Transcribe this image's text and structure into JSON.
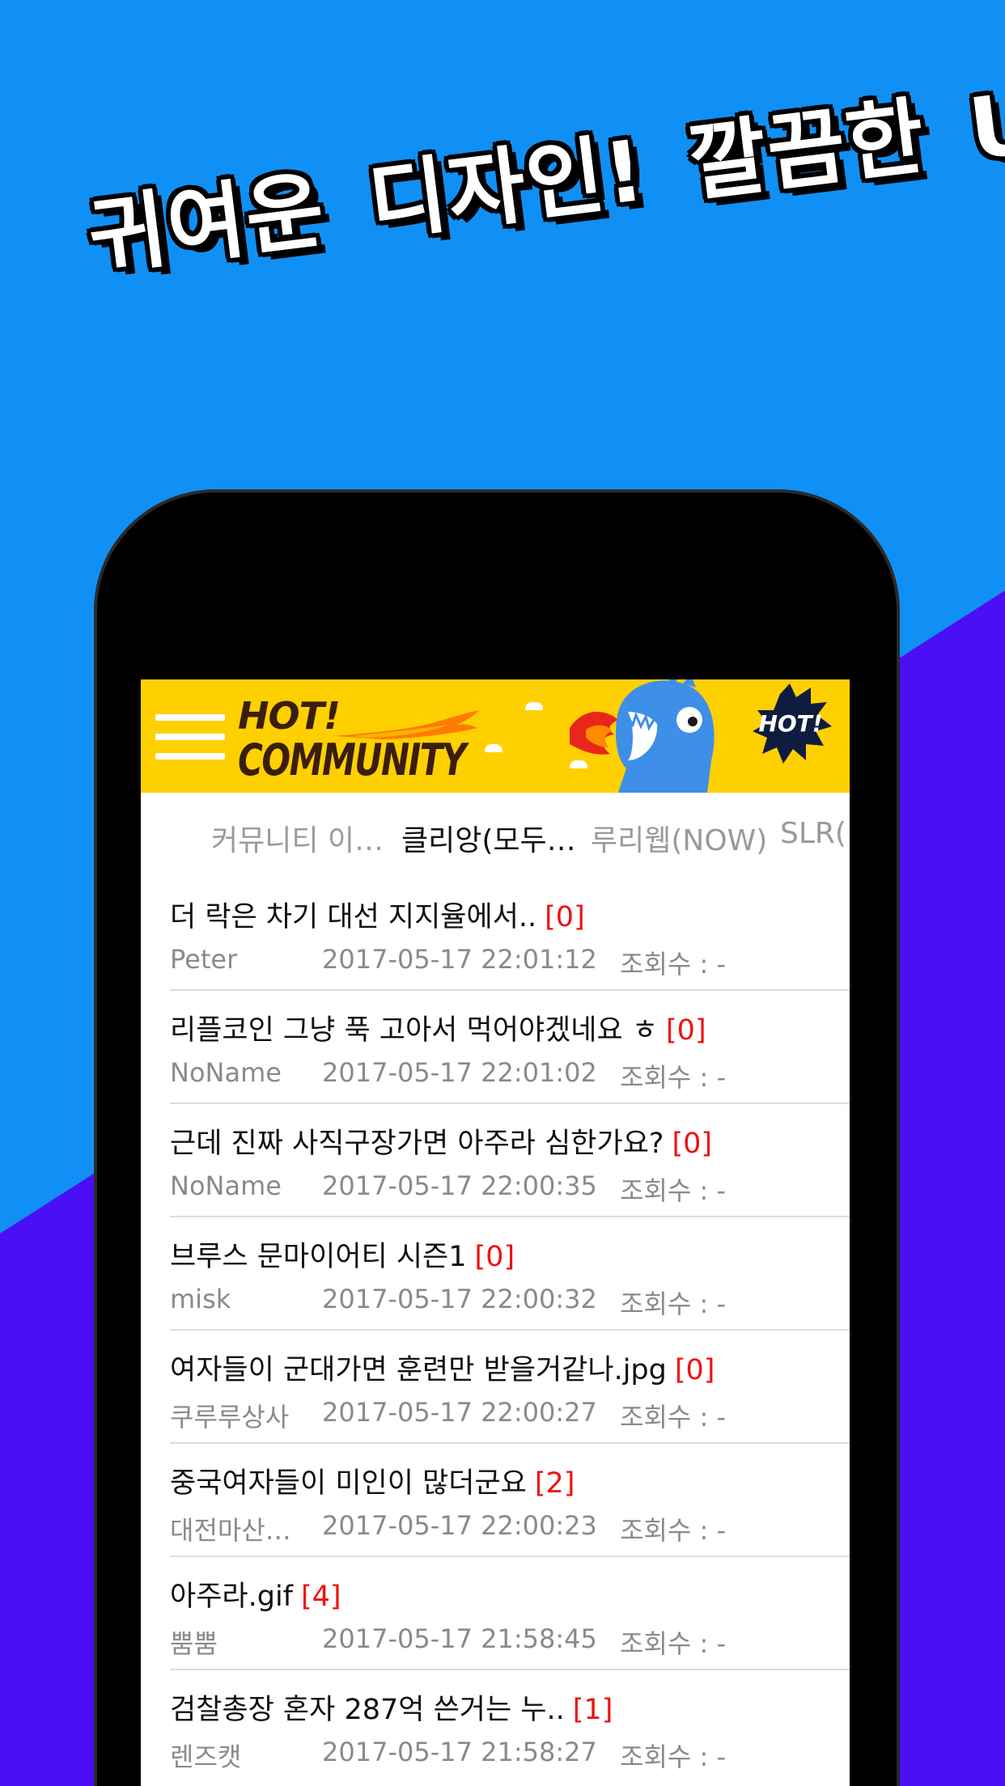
{
  "promo": {
    "words": [
      "귀여운",
      "디자인!",
      "깔끔한",
      "UI!"
    ]
  },
  "header": {
    "logo_line1": "HOT!",
    "logo_line2": "COMMUNITY",
    "badge": "HOT!",
    "colors": {
      "bar": "#ffd000",
      "logo_text": "#3a1e0c",
      "mascot": "#3d8fe8"
    }
  },
  "tabs": [
    {
      "label": "커뮤니티 이…",
      "active": false
    },
    {
      "label": "클리앙(모두…",
      "active": true
    },
    {
      "label": "루리웹(NOW)",
      "active": false
    },
    {
      "label": "SLR(",
      "active": false
    }
  ],
  "meta_views_label": "조회수 :  -",
  "posts": [
    {
      "title": "더 락은 차기 대선 지지율에서..",
      "count": "[0]",
      "author": "Peter",
      "date": "2017-05-17 22:01:12"
    },
    {
      "title": "리플코인 그냥 푹 고아서 먹어야겠네요 ㅎ",
      "count": "[0]",
      "author": "NoName",
      "date": "2017-05-17 22:01:02"
    },
    {
      "title": "근데 진짜 사직구장가면 아주라 심한가요?",
      "count": "[0]",
      "author": "NoName",
      "date": "2017-05-17 22:00:35"
    },
    {
      "title": "브루스 문마이어티 시즌1",
      "count": "[0]",
      "author": "misk",
      "date": "2017-05-17 22:00:32"
    },
    {
      "title": "여자들이 군대가면 훈련만 받을거같나.jpg",
      "count": "[0]",
      "author": "쿠루루상사",
      "date": "2017-05-17 22:00:27"
    },
    {
      "title": "중국여자들이 미인이 많더군요",
      "count": "[2]",
      "author": "대전마산…",
      "date": "2017-05-17 22:00:23"
    },
    {
      "title": "아주라.gif",
      "count": "[4]",
      "author": "뿜뿜",
      "date": "2017-05-17 21:58:45"
    },
    {
      "title": "검찰총장 혼자 287억 쓴거는 누..",
      "count": "[1]",
      "author": "렌즈캣",
      "date": "2017-05-17 21:58:27"
    }
  ]
}
